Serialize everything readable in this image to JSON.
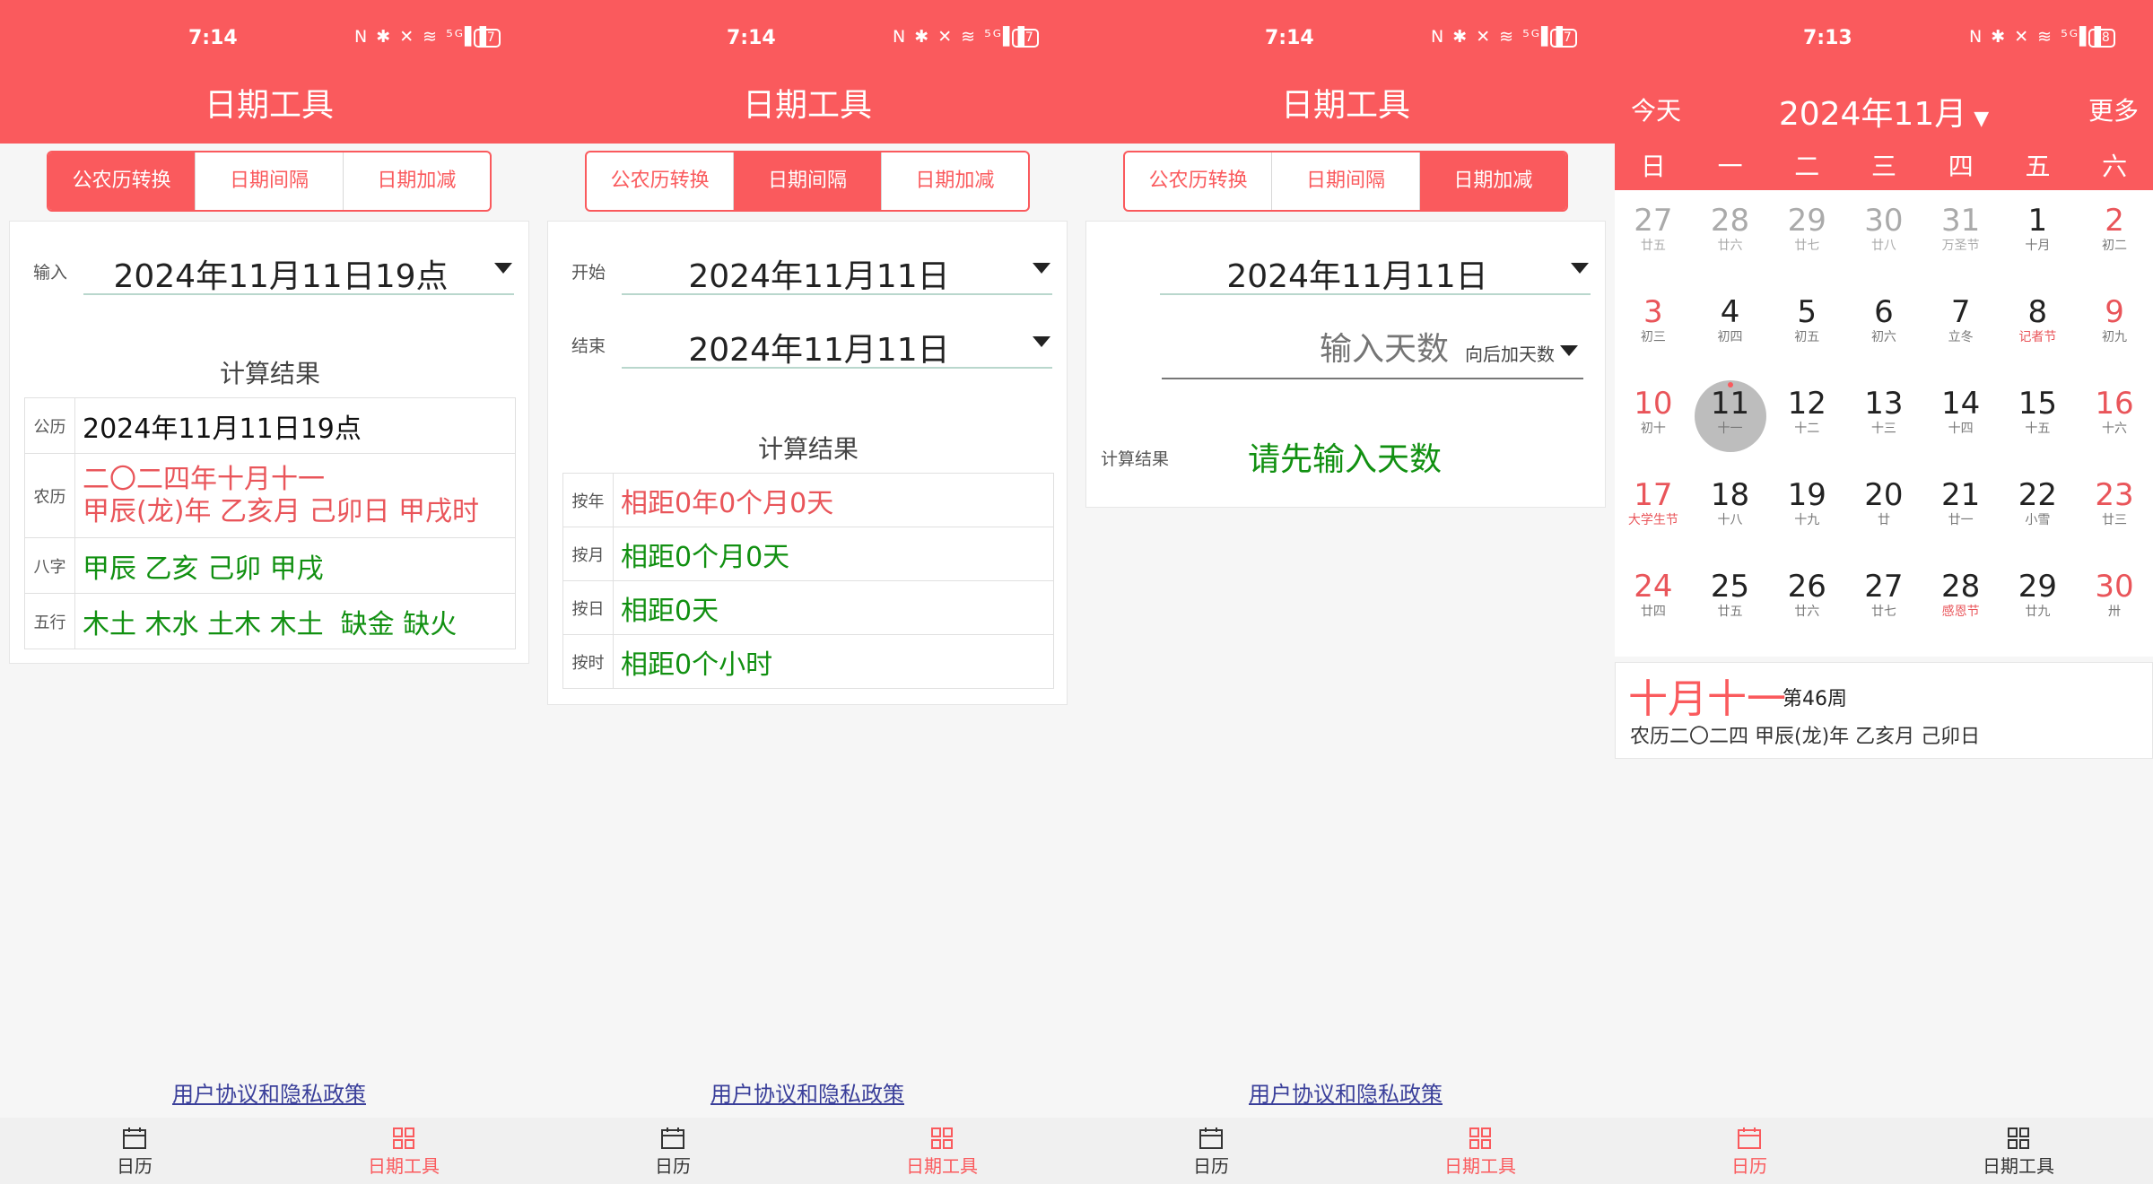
{
  "colors": {
    "accent": "#fa5a5d",
    "green": "#119011",
    "link": "#3a3f9a"
  },
  "common": {
    "app_title": "日期工具",
    "tabs": [
      "公农历转换",
      "日期间隔",
      "日期加减"
    ],
    "privacy": "用户协议和隐私政策",
    "nav": [
      "日历",
      "日期工具"
    ],
    "status_icons": "N ✱ ✕ ≋ ⁵ᴳ▌▌"
  },
  "s1": {
    "time": "7:14",
    "battery": "87",
    "input_label": "输入",
    "input_value": "2024年11月11日19点",
    "result_title": "计算结果",
    "rows": [
      {
        "k": "公历",
        "v": "2024年11月11日19点"
      },
      {
        "k": "农历",
        "v": "二〇二四年十月十一",
        "v2": "甲辰(龙)年 乙亥月 己卯日 甲戌时"
      },
      {
        "k": "八字",
        "v": "甲辰 乙亥 己卯 甲戌"
      },
      {
        "k": "五行",
        "v": "木土 木水 土木 木土  缺金 缺火"
      }
    ]
  },
  "s2": {
    "time": "7:14",
    "battery": "87",
    "start_label": "开始",
    "start_value": "2024年11月11日",
    "end_label": "结束",
    "end_value": "2024年11月11日",
    "result_title": "计算结果",
    "rows": [
      {
        "k": "按年",
        "v": "相距0年0个月0天"
      },
      {
        "k": "按月",
        "v": "相距0个月0天"
      },
      {
        "k": "按日",
        "v": "相距0天"
      },
      {
        "k": "按时",
        "v": "相距0个小时"
      }
    ]
  },
  "s3": {
    "time": "7:14",
    "battery": "87",
    "date_value": "2024年11月11日",
    "days_placeholder": "输入天数",
    "direction": "向后加天数",
    "result_label": "计算结果",
    "result_value": "请先输入天数"
  },
  "s4": {
    "time": "7:13",
    "battery": "88",
    "today": "今天",
    "month": "2024年11月",
    "more": "更多",
    "weekdays": [
      "日",
      "一",
      "二",
      "三",
      "四",
      "五",
      "六"
    ],
    "days": [
      {
        "n": "27",
        "l": "廿五",
        "om": true
      },
      {
        "n": "28",
        "l": "廿六",
        "om": true
      },
      {
        "n": "29",
        "l": "廿七",
        "om": true
      },
      {
        "n": "30",
        "l": "廿八",
        "om": true
      },
      {
        "n": "31",
        "l": "万圣节",
        "om": true
      },
      {
        "n": "1",
        "l": "十月"
      },
      {
        "n": "2",
        "l": "初二"
      },
      {
        "n": "3",
        "l": "初三"
      },
      {
        "n": "4",
        "l": "初四"
      },
      {
        "n": "5",
        "l": "初五"
      },
      {
        "n": "6",
        "l": "初六"
      },
      {
        "n": "7",
        "l": "立冬"
      },
      {
        "n": "8",
        "l": "记者节",
        "hol": true
      },
      {
        "n": "9",
        "l": "初九"
      },
      {
        "n": "10",
        "l": "初十"
      },
      {
        "n": "11",
        "l": "十一",
        "sel": true
      },
      {
        "n": "12",
        "l": "十二"
      },
      {
        "n": "13",
        "l": "十三"
      },
      {
        "n": "14",
        "l": "十四"
      },
      {
        "n": "15",
        "l": "十五"
      },
      {
        "n": "16",
        "l": "十六"
      },
      {
        "n": "17",
        "l": "大学生节",
        "hol": true
      },
      {
        "n": "18",
        "l": "十八"
      },
      {
        "n": "19",
        "l": "十九"
      },
      {
        "n": "20",
        "l": "廿"
      },
      {
        "n": "21",
        "l": "廿一"
      },
      {
        "n": "22",
        "l": "小雪"
      },
      {
        "n": "23",
        "l": "廿三"
      },
      {
        "n": "24",
        "l": "廿四"
      },
      {
        "n": "25",
        "l": "廿五"
      },
      {
        "n": "26",
        "l": "廿六"
      },
      {
        "n": "27",
        "l": "廿七"
      },
      {
        "n": "28",
        "l": "感恩节",
        "hol": true
      },
      {
        "n": "29",
        "l": "廿九"
      },
      {
        "n": "30",
        "l": "卅"
      }
    ],
    "lunar_big": "十月十一",
    "week_no": "第46周",
    "lunar_line": "农历二〇二四 甲辰(龙)年 乙亥月 己卯日"
  }
}
